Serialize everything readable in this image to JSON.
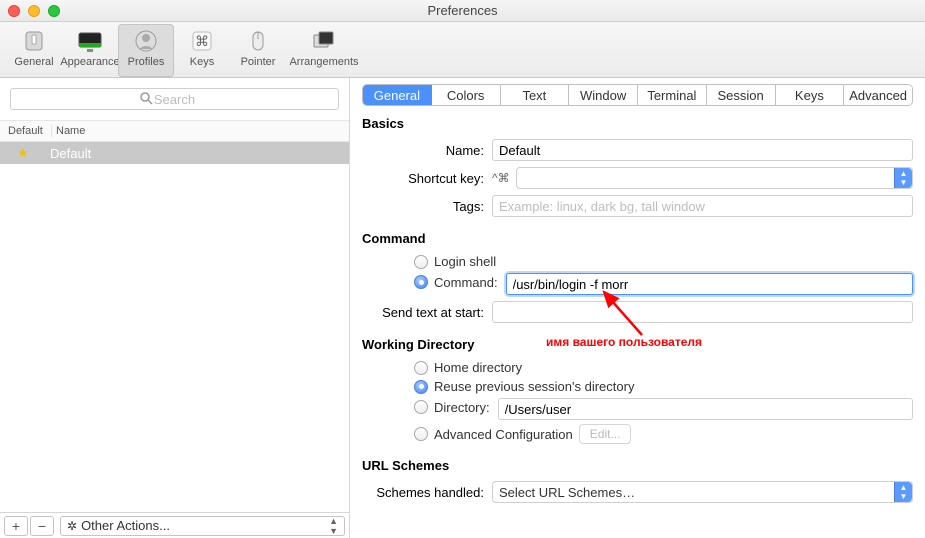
{
  "window": {
    "title": "Preferences"
  },
  "toolbar": {
    "items": [
      {
        "label": "General"
      },
      {
        "label": "Appearance"
      },
      {
        "label": "Profiles"
      },
      {
        "label": "Keys"
      },
      {
        "label": "Pointer"
      },
      {
        "label": "Arrangements"
      }
    ]
  },
  "sidebar": {
    "search_placeholder": "Search",
    "columns": {
      "c1": "Default",
      "c2": "Name"
    },
    "rows": [
      {
        "name": "Default"
      }
    ],
    "add_label": "+",
    "remove_label": "−",
    "other_actions": "Other Actions..."
  },
  "tabs": [
    "General",
    "Colors",
    "Text",
    "Window",
    "Terminal",
    "Session",
    "Keys",
    "Advanced"
  ],
  "basics": {
    "heading": "Basics",
    "name_label": "Name:",
    "name_value": "Default",
    "shortcut_label": "Shortcut key:",
    "shortcut_sym": "^⌘",
    "tags_label": "Tags:",
    "tags_placeholder": "Example: linux, dark bg, tall window"
  },
  "command": {
    "heading": "Command",
    "login_shell": "Login shell",
    "command_label": "Command:",
    "command_value": "/usr/bin/login -f morr",
    "send_label": "Send text at start:",
    "send_value": ""
  },
  "workdir": {
    "heading": "Working Directory",
    "home": "Home directory",
    "reuse": "Reuse previous session's directory",
    "dir_label": "Directory:",
    "dir_value": "/Users/user",
    "adv": "Advanced Configuration",
    "edit": "Edit..."
  },
  "url": {
    "heading": "URL Schemes",
    "label": "Schemes handled:",
    "value": "Select URL Schemes…"
  },
  "annotation": "имя вашего пользователя"
}
